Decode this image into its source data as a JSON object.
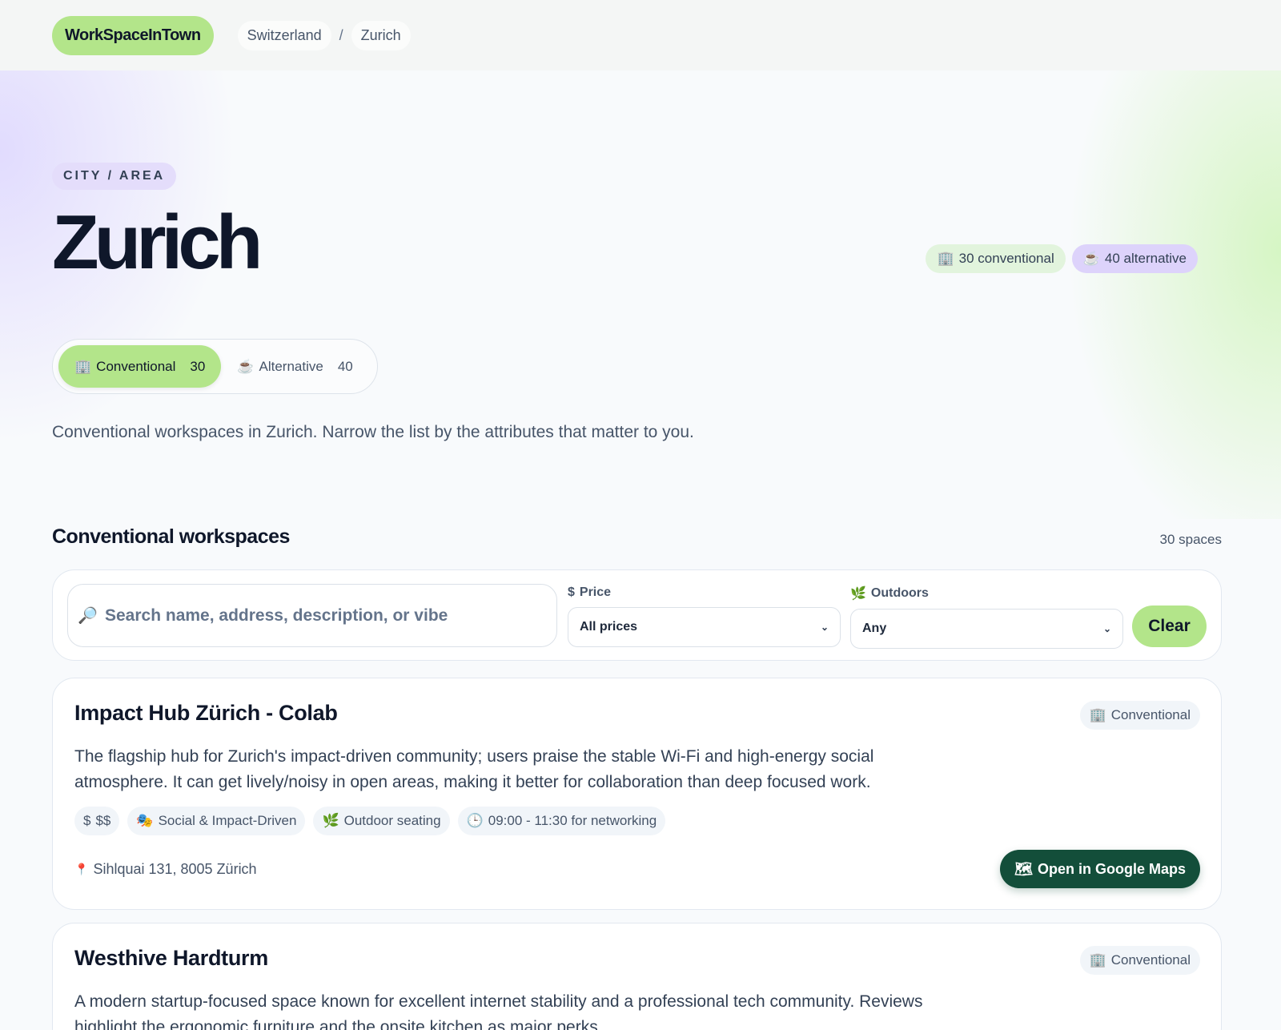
{
  "header": {
    "logo": "WorkSpaceInTown",
    "breadcrumb": [
      "Switzerland",
      "Zurich"
    ],
    "separator": "/"
  },
  "hero": {
    "eyebrow": "CITY / AREA",
    "title": "Zurich",
    "stats": [
      {
        "icon": "office-building-icon",
        "glyph": "🏢",
        "label": "30 conventional"
      },
      {
        "icon": "coffee-icon",
        "glyph": "☕",
        "label": "40 alternative"
      }
    ],
    "tabs": [
      {
        "icon": "office-building-icon",
        "glyph": "🏢",
        "label": "Conventional",
        "count": "30",
        "active": true
      },
      {
        "icon": "coffee-icon",
        "glyph": "☕",
        "label": "Alternative",
        "count": "40",
        "active": false
      }
    ],
    "description": "Conventional workspaces in Zurich. Narrow the list by the attributes that matter to you."
  },
  "section": {
    "title": "Conventional workspaces",
    "count": "30 spaces"
  },
  "filters": {
    "search": {
      "icon": "search-icon",
      "glyph": "🔎",
      "placeholder": "Search name, address, description, or vibe",
      "value": ""
    },
    "price": {
      "icon": "dollar-icon",
      "glyph": "$",
      "label": "Price",
      "value": "All prices"
    },
    "outdoors": {
      "icon": "leaf-icon",
      "glyph": "🌿",
      "label": "Outdoors",
      "value": "Any"
    },
    "clear_label": "Clear"
  },
  "cards": [
    {
      "title": "Impact Hub Zürich - Colab",
      "badge": {
        "glyph": "🏢",
        "label": "Conventional"
      },
      "description": "The flagship hub for Zurich's impact-driven community; users praise the stable Wi-Fi and high-energy social atmosphere. It can get lively/noisy in open areas, making it better for collaboration than deep focused work.",
      "tags": [
        {
          "icon": "dollar-icon",
          "glyph": "$",
          "label": "$$"
        },
        {
          "icon": "theater-masks-icon",
          "glyph": "🎭",
          "label": "Social & Impact-Driven"
        },
        {
          "icon": "leaf-icon",
          "glyph": "🌿",
          "label": "Outdoor seating"
        },
        {
          "icon": "clock-icon",
          "glyph": "🕒",
          "label": "09:00 - 11:30 for networking"
        }
      ],
      "address": "Sihlquai 131, 8005 Zürich",
      "maps_label": "Open in Google Maps",
      "maps_glyph": "🗺"
    },
    {
      "title": "Westhive Hardturm",
      "badge": {
        "glyph": "🏢",
        "label": "Conventional"
      },
      "description": "A modern startup-focused space known for excellent internet stability and a professional tech community. Reviews highlight the ergonomic furniture and the onsite kitchen as major perks."
    }
  ],
  "colors": {
    "accent_green": "#b3e58a",
    "accent_purple": "#ddd3fb",
    "dark_green": "#134e3a"
  }
}
